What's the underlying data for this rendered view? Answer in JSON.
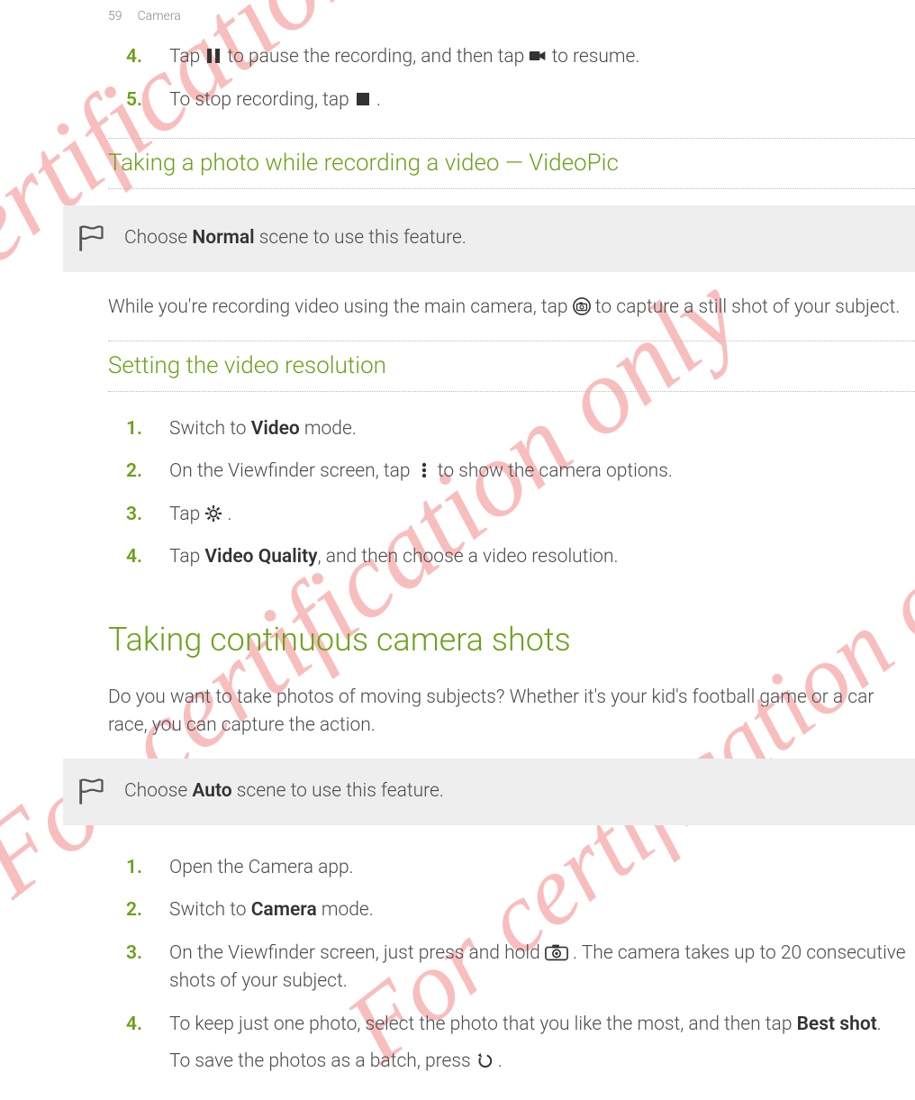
{
  "header": {
    "page_number": "59",
    "section": "Camera"
  },
  "watermark": "For certification only",
  "top_steps": [
    {
      "num": "4.",
      "pre": "Tap ",
      "mid": " to pause the recording, and then tap ",
      "post": " to resume."
    },
    {
      "num": "5.",
      "pre": "To stop recording, tap ",
      "post": "."
    }
  ],
  "videopic": {
    "heading": "Taking a photo while recording a video — VideoPic",
    "note_pre": "Choose ",
    "note_strong": "Normal",
    "note_post": " scene to use this feature.",
    "body_pre": "While you're recording video using the main camera, tap ",
    "body_post": " to capture a still shot of your subject."
  },
  "resolution": {
    "heading": "Setting the video resolution",
    "steps": [
      {
        "num": "1.",
        "pre": "Switch to ",
        "strong": "Video",
        "post": " mode."
      },
      {
        "num": "2.",
        "pre": "On the Viewfinder screen, tap ",
        "post": " to show the camera options."
      },
      {
        "num": "3.",
        "pre": "Tap ",
        "post": "."
      },
      {
        "num": "4.",
        "pre": "Tap ",
        "strong": "Video Quality",
        "post": ", and then choose a video resolution."
      }
    ]
  },
  "continuous": {
    "heading": "Taking continuous camera shots",
    "intro": "Do you want to take photos of moving subjects? Whether it's your kid's football game or a car race, you can capture the action.",
    "note_pre": "Choose ",
    "note_strong": "Auto",
    "note_post": " scene to use this feature.",
    "steps": [
      {
        "num": "1.",
        "text": "Open the Camera app."
      },
      {
        "num": "2.",
        "pre": "Switch to ",
        "strong": "Camera",
        "post": " mode."
      },
      {
        "num": "3.",
        "pre": "On the Viewfinder screen, just press and hold ",
        "post": ". The camera takes up to 20 consecutive shots of your subject."
      },
      {
        "num": "4.",
        "pre": "To keep just one photo, select the photo that you like the most, and then tap ",
        "strong": "Best shot",
        "post": ".",
        "sub_pre": "To save the photos as a batch, press ",
        "sub_post": "."
      }
    ]
  }
}
